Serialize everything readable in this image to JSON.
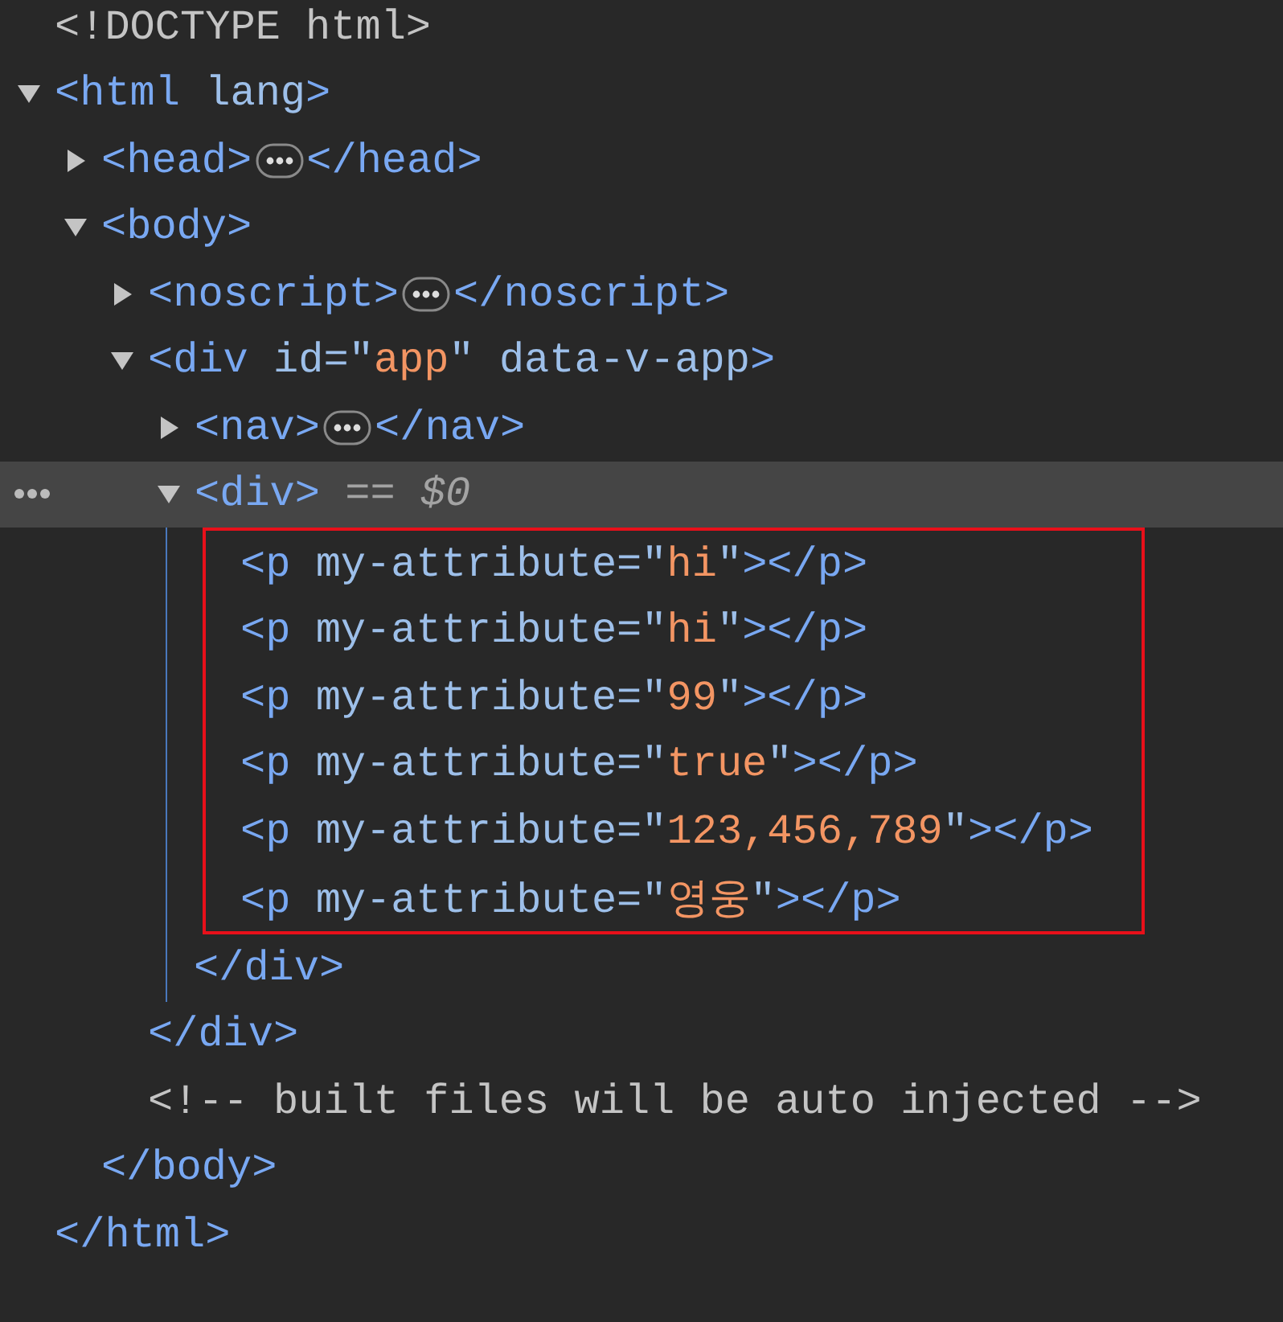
{
  "nodes": [
    {
      "selected": false,
      "parts": [
        {
          "kind": "doctype",
          "text": "<!DOCTYPE html>"
        }
      ]
    },
    {
      "selected": false,
      "expanded": true,
      "parts": [
        {
          "kind": "tag",
          "text": "<html "
        },
        {
          "kind": "attr",
          "text": "lang"
        },
        {
          "kind": "tag",
          "text": ">"
        }
      ],
      "children": [
        {
          "selected": false,
          "expanded": false,
          "parts": [
            {
              "kind": "tag",
              "text": "<head>"
            },
            {
              "kind": "badge"
            },
            {
              "kind": "tag",
              "text": "</head>"
            }
          ]
        },
        {
          "selected": false,
          "expanded": true,
          "parts": [
            {
              "kind": "tag",
              "text": "<body>"
            }
          ],
          "children": [
            {
              "selected": false,
              "expanded": false,
              "parts": [
                {
                  "kind": "tag",
                  "text": "<noscript>"
                },
                {
                  "kind": "badge"
                },
                {
                  "kind": "tag",
                  "text": "</noscript>"
                }
              ]
            },
            {
              "selected": false,
              "expanded": true,
              "parts": [
                {
                  "kind": "tag",
                  "text": "<div "
                },
                {
                  "kind": "attr",
                  "text": "id=\""
                },
                {
                  "kind": "value",
                  "text": "app"
                },
                {
                  "kind": "attr",
                  "text": "\" data-v-app"
                },
                {
                  "kind": "tag",
                  "text": ">"
                }
              ],
              "children": [
                {
                  "selected": false,
                  "expanded": false,
                  "parts": [
                    {
                      "kind": "tag",
                      "text": "<nav>"
                    },
                    {
                      "kind": "badge"
                    },
                    {
                      "kind": "tag",
                      "text": "</nav>"
                    }
                  ]
                },
                {
                  "selected": true,
                  "expanded": true,
                  "children_outlined": true,
                  "parts": [
                    {
                      "kind": "tag",
                      "text": "<div>"
                    },
                    {
                      "kind": "marker",
                      "text": " == $0"
                    }
                  ],
                  "children": [
                    {
                      "selected": false,
                      "parts": [
                        {
                          "kind": "tag",
                          "text": "<p "
                        },
                        {
                          "kind": "attr",
                          "text": "my-attribute=\""
                        },
                        {
                          "kind": "value",
                          "text": "hi"
                        },
                        {
                          "kind": "attr",
                          "text": "\""
                        },
                        {
                          "kind": "tag",
                          "text": "></p>"
                        }
                      ]
                    },
                    {
                      "selected": false,
                      "parts": [
                        {
                          "kind": "tag",
                          "text": "<p "
                        },
                        {
                          "kind": "attr",
                          "text": "my-attribute=\""
                        },
                        {
                          "kind": "value",
                          "text": "hi"
                        },
                        {
                          "kind": "attr",
                          "text": "\""
                        },
                        {
                          "kind": "tag",
                          "text": "></p>"
                        }
                      ]
                    },
                    {
                      "selected": false,
                      "parts": [
                        {
                          "kind": "tag",
                          "text": "<p "
                        },
                        {
                          "kind": "attr",
                          "text": "my-attribute=\""
                        },
                        {
                          "kind": "value",
                          "text": "99"
                        },
                        {
                          "kind": "attr",
                          "text": "\""
                        },
                        {
                          "kind": "tag",
                          "text": "></p>"
                        }
                      ]
                    },
                    {
                      "selected": false,
                      "parts": [
                        {
                          "kind": "tag",
                          "text": "<p "
                        },
                        {
                          "kind": "attr",
                          "text": "my-attribute=\""
                        },
                        {
                          "kind": "value",
                          "text": "true"
                        },
                        {
                          "kind": "attr",
                          "text": "\""
                        },
                        {
                          "kind": "tag",
                          "text": "></p>"
                        }
                      ]
                    },
                    {
                      "selected": false,
                      "parts": [
                        {
                          "kind": "tag",
                          "text": "<p "
                        },
                        {
                          "kind": "attr",
                          "text": "my-attribute=\""
                        },
                        {
                          "kind": "value",
                          "text": "123,456,789"
                        },
                        {
                          "kind": "attr",
                          "text": "\""
                        },
                        {
                          "kind": "tag",
                          "text": "></p>"
                        }
                      ]
                    },
                    {
                      "selected": false,
                      "parts": [
                        {
                          "kind": "tag",
                          "text": "<p "
                        },
                        {
                          "kind": "attr",
                          "text": "my-attribute=\""
                        },
                        {
                          "kind": "value",
                          "text": "영웅"
                        },
                        {
                          "kind": "attr",
                          "text": "\""
                        },
                        {
                          "kind": "tag",
                          "text": "></p>"
                        }
                      ]
                    }
                  ],
                  "closing": "</div>"
                }
              ],
              "closing": "</div>"
            },
            {
              "selected": false,
              "parts": [
                {
                  "kind": "comment",
                  "text": "<!-- built files will be auto injected -->"
                }
              ]
            }
          ],
          "closing": "</body>"
        }
      ],
      "closing": "</html>"
    }
  ]
}
